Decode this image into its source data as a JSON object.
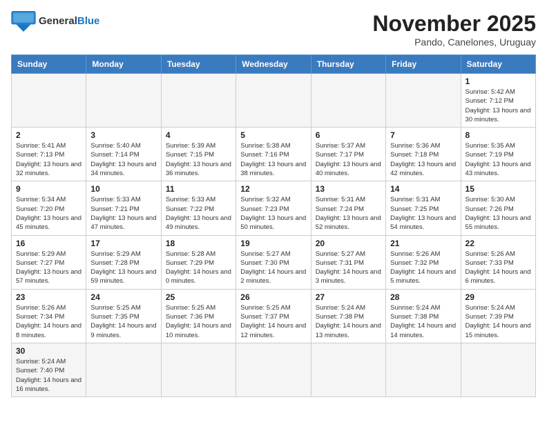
{
  "header": {
    "logo_general": "General",
    "logo_blue": "Blue",
    "month_year": "November 2025",
    "location": "Pando, Canelones, Uruguay"
  },
  "weekdays": [
    "Sunday",
    "Monday",
    "Tuesday",
    "Wednesday",
    "Thursday",
    "Friday",
    "Saturday"
  ],
  "weeks": [
    [
      {
        "day": "",
        "empty": true
      },
      {
        "day": "",
        "empty": true
      },
      {
        "day": "",
        "empty": true
      },
      {
        "day": "",
        "empty": true
      },
      {
        "day": "",
        "empty": true
      },
      {
        "day": "",
        "empty": true
      },
      {
        "day": "1",
        "sunrise": "5:42 AM",
        "sunset": "7:12 PM",
        "daylight": "13 hours and 30 minutes."
      }
    ],
    [
      {
        "day": "2",
        "sunrise": "5:41 AM",
        "sunset": "7:13 PM",
        "daylight": "13 hours and 32 minutes."
      },
      {
        "day": "3",
        "sunrise": "5:40 AM",
        "sunset": "7:14 PM",
        "daylight": "13 hours and 34 minutes."
      },
      {
        "day": "4",
        "sunrise": "5:39 AM",
        "sunset": "7:15 PM",
        "daylight": "13 hours and 36 minutes."
      },
      {
        "day": "5",
        "sunrise": "5:38 AM",
        "sunset": "7:16 PM",
        "daylight": "13 hours and 38 minutes."
      },
      {
        "day": "6",
        "sunrise": "5:37 AM",
        "sunset": "7:17 PM",
        "daylight": "13 hours and 40 minutes."
      },
      {
        "day": "7",
        "sunrise": "5:36 AM",
        "sunset": "7:18 PM",
        "daylight": "13 hours and 42 minutes."
      },
      {
        "day": "8",
        "sunrise": "5:35 AM",
        "sunset": "7:19 PM",
        "daylight": "13 hours and 43 minutes."
      }
    ],
    [
      {
        "day": "9",
        "sunrise": "5:34 AM",
        "sunset": "7:20 PM",
        "daylight": "13 hours and 45 minutes."
      },
      {
        "day": "10",
        "sunrise": "5:33 AM",
        "sunset": "7:21 PM",
        "daylight": "13 hours and 47 minutes."
      },
      {
        "day": "11",
        "sunrise": "5:33 AM",
        "sunset": "7:22 PM",
        "daylight": "13 hours and 49 minutes."
      },
      {
        "day": "12",
        "sunrise": "5:32 AM",
        "sunset": "7:23 PM",
        "daylight": "13 hours and 50 minutes."
      },
      {
        "day": "13",
        "sunrise": "5:31 AM",
        "sunset": "7:24 PM",
        "daylight": "13 hours and 52 minutes."
      },
      {
        "day": "14",
        "sunrise": "5:31 AM",
        "sunset": "7:25 PM",
        "daylight": "13 hours and 54 minutes."
      },
      {
        "day": "15",
        "sunrise": "5:30 AM",
        "sunset": "7:26 PM",
        "daylight": "13 hours and 55 minutes."
      }
    ],
    [
      {
        "day": "16",
        "sunrise": "5:29 AM",
        "sunset": "7:27 PM",
        "daylight": "13 hours and 57 minutes."
      },
      {
        "day": "17",
        "sunrise": "5:29 AM",
        "sunset": "7:28 PM",
        "daylight": "13 hours and 59 minutes."
      },
      {
        "day": "18",
        "sunrise": "5:28 AM",
        "sunset": "7:29 PM",
        "daylight": "14 hours and 0 minutes."
      },
      {
        "day": "19",
        "sunrise": "5:27 AM",
        "sunset": "7:30 PM",
        "daylight": "14 hours and 2 minutes."
      },
      {
        "day": "20",
        "sunrise": "5:27 AM",
        "sunset": "7:31 PM",
        "daylight": "14 hours and 3 minutes."
      },
      {
        "day": "21",
        "sunrise": "5:26 AM",
        "sunset": "7:32 PM",
        "daylight": "14 hours and 5 minutes."
      },
      {
        "day": "22",
        "sunrise": "5:26 AM",
        "sunset": "7:33 PM",
        "daylight": "14 hours and 6 minutes."
      }
    ],
    [
      {
        "day": "23",
        "sunrise": "5:26 AM",
        "sunset": "7:34 PM",
        "daylight": "14 hours and 8 minutes."
      },
      {
        "day": "24",
        "sunrise": "5:25 AM",
        "sunset": "7:35 PM",
        "daylight": "14 hours and 9 minutes."
      },
      {
        "day": "25",
        "sunrise": "5:25 AM",
        "sunset": "7:36 PM",
        "daylight": "14 hours and 10 minutes."
      },
      {
        "day": "26",
        "sunrise": "5:25 AM",
        "sunset": "7:37 PM",
        "daylight": "14 hours and 12 minutes."
      },
      {
        "day": "27",
        "sunrise": "5:24 AM",
        "sunset": "7:38 PM",
        "daylight": "14 hours and 13 minutes."
      },
      {
        "day": "28",
        "sunrise": "5:24 AM",
        "sunset": "7:38 PM",
        "daylight": "14 hours and 14 minutes."
      },
      {
        "day": "29",
        "sunrise": "5:24 AM",
        "sunset": "7:39 PM",
        "daylight": "14 hours and 15 minutes."
      }
    ],
    [
      {
        "day": "30",
        "sunrise": "5:24 AM",
        "sunset": "7:40 PM",
        "daylight": "14 hours and 16 minutes."
      },
      {
        "day": "",
        "empty": true
      },
      {
        "day": "",
        "empty": true
      },
      {
        "day": "",
        "empty": true
      },
      {
        "day": "",
        "empty": true
      },
      {
        "day": "",
        "empty": true
      },
      {
        "day": "",
        "empty": true
      }
    ]
  ],
  "labels": {
    "sunrise": "Sunrise:",
    "sunset": "Sunset:",
    "daylight": "Daylight:"
  }
}
